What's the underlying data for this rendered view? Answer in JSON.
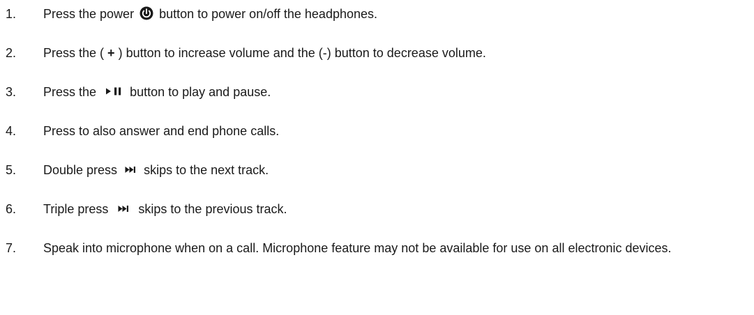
{
  "instructions": [
    {
      "number": "1.",
      "before": "Press the power",
      "icon": "power-icon",
      "after": "button to power on/off the headphones."
    },
    {
      "number": "2.",
      "before": "Press the (",
      "plus": "+",
      "middle": ") button to increase volume and the (-) button to decrease volume."
    },
    {
      "number": "3.",
      "before": "Press the",
      "icon": "play-pause-icon",
      "after": "button to play and pause."
    },
    {
      "number": "4.",
      "text": "Press to also answer and end phone calls."
    },
    {
      "number": "5.",
      "before": "Double press",
      "icon": "next-track-icon",
      "after": "skips to the next track."
    },
    {
      "number": "6.",
      "before": "Triple press",
      "icon": "next-track-icon",
      "after": "skips to the previous track."
    },
    {
      "number": "7.",
      "text": "Speak into microphone when on a call. Microphone feature may not be available for use on all electronic devices."
    }
  ],
  "colors": {
    "text": "#1a1a1a",
    "icon": "#1a1a1a"
  }
}
